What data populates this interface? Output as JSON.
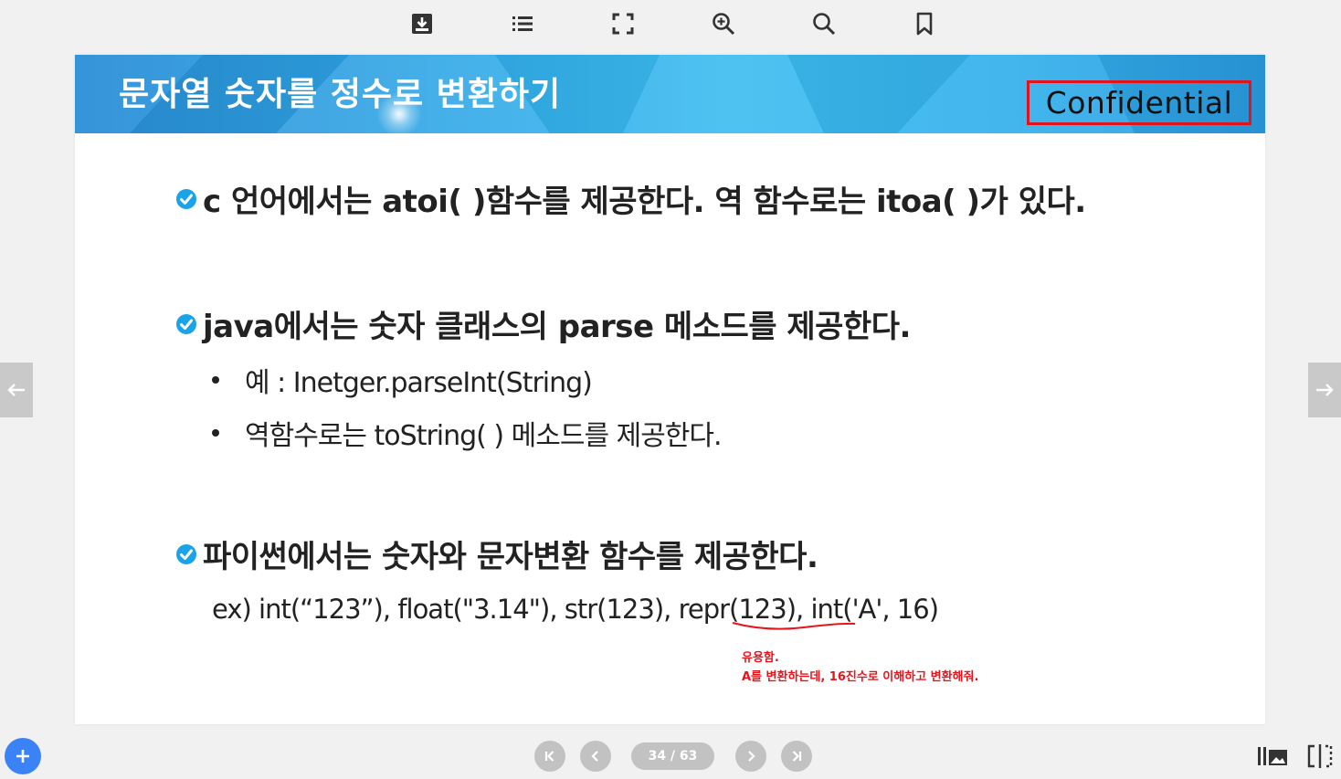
{
  "toolbar": {
    "icons": [
      "download-icon",
      "list-icon",
      "fullscreen-icon",
      "zoom-in-icon",
      "search-icon",
      "bookmark-icon"
    ]
  },
  "slide": {
    "title": "문자열 숫자를 정수로 변환하기",
    "confidential": "Confidential",
    "bullets": [
      "c 언어에서는 atoi( )함수를 제공한다. 역 함수로는 itoa( )가 있다.",
      "java에서는 숫자 클래스의 parse 메소드를 제공한다.",
      "파이썬에서는 숫자와 문자변환 함수를 제공한다."
    ],
    "java_subitems": [
      "예 : Inetger.parseInt(String)",
      "역함수로는 toString( ) 메소드를 제공한다."
    ],
    "example": "ex) int(“123”), float(\"3.14\"), str(123), repr(123), int('A', 16)",
    "note_lines": [
      "유용함.",
      "A를 변환하는데, 16진수로 이해하고 변환해줘."
    ]
  },
  "pagination": {
    "page_label": "34 / 63"
  },
  "colors": {
    "accent_blue": "#3b82f6",
    "check_blue": "#1aa3e8",
    "annotation_red": "#e8141c",
    "nav_gray": "#c2c2c2"
  }
}
